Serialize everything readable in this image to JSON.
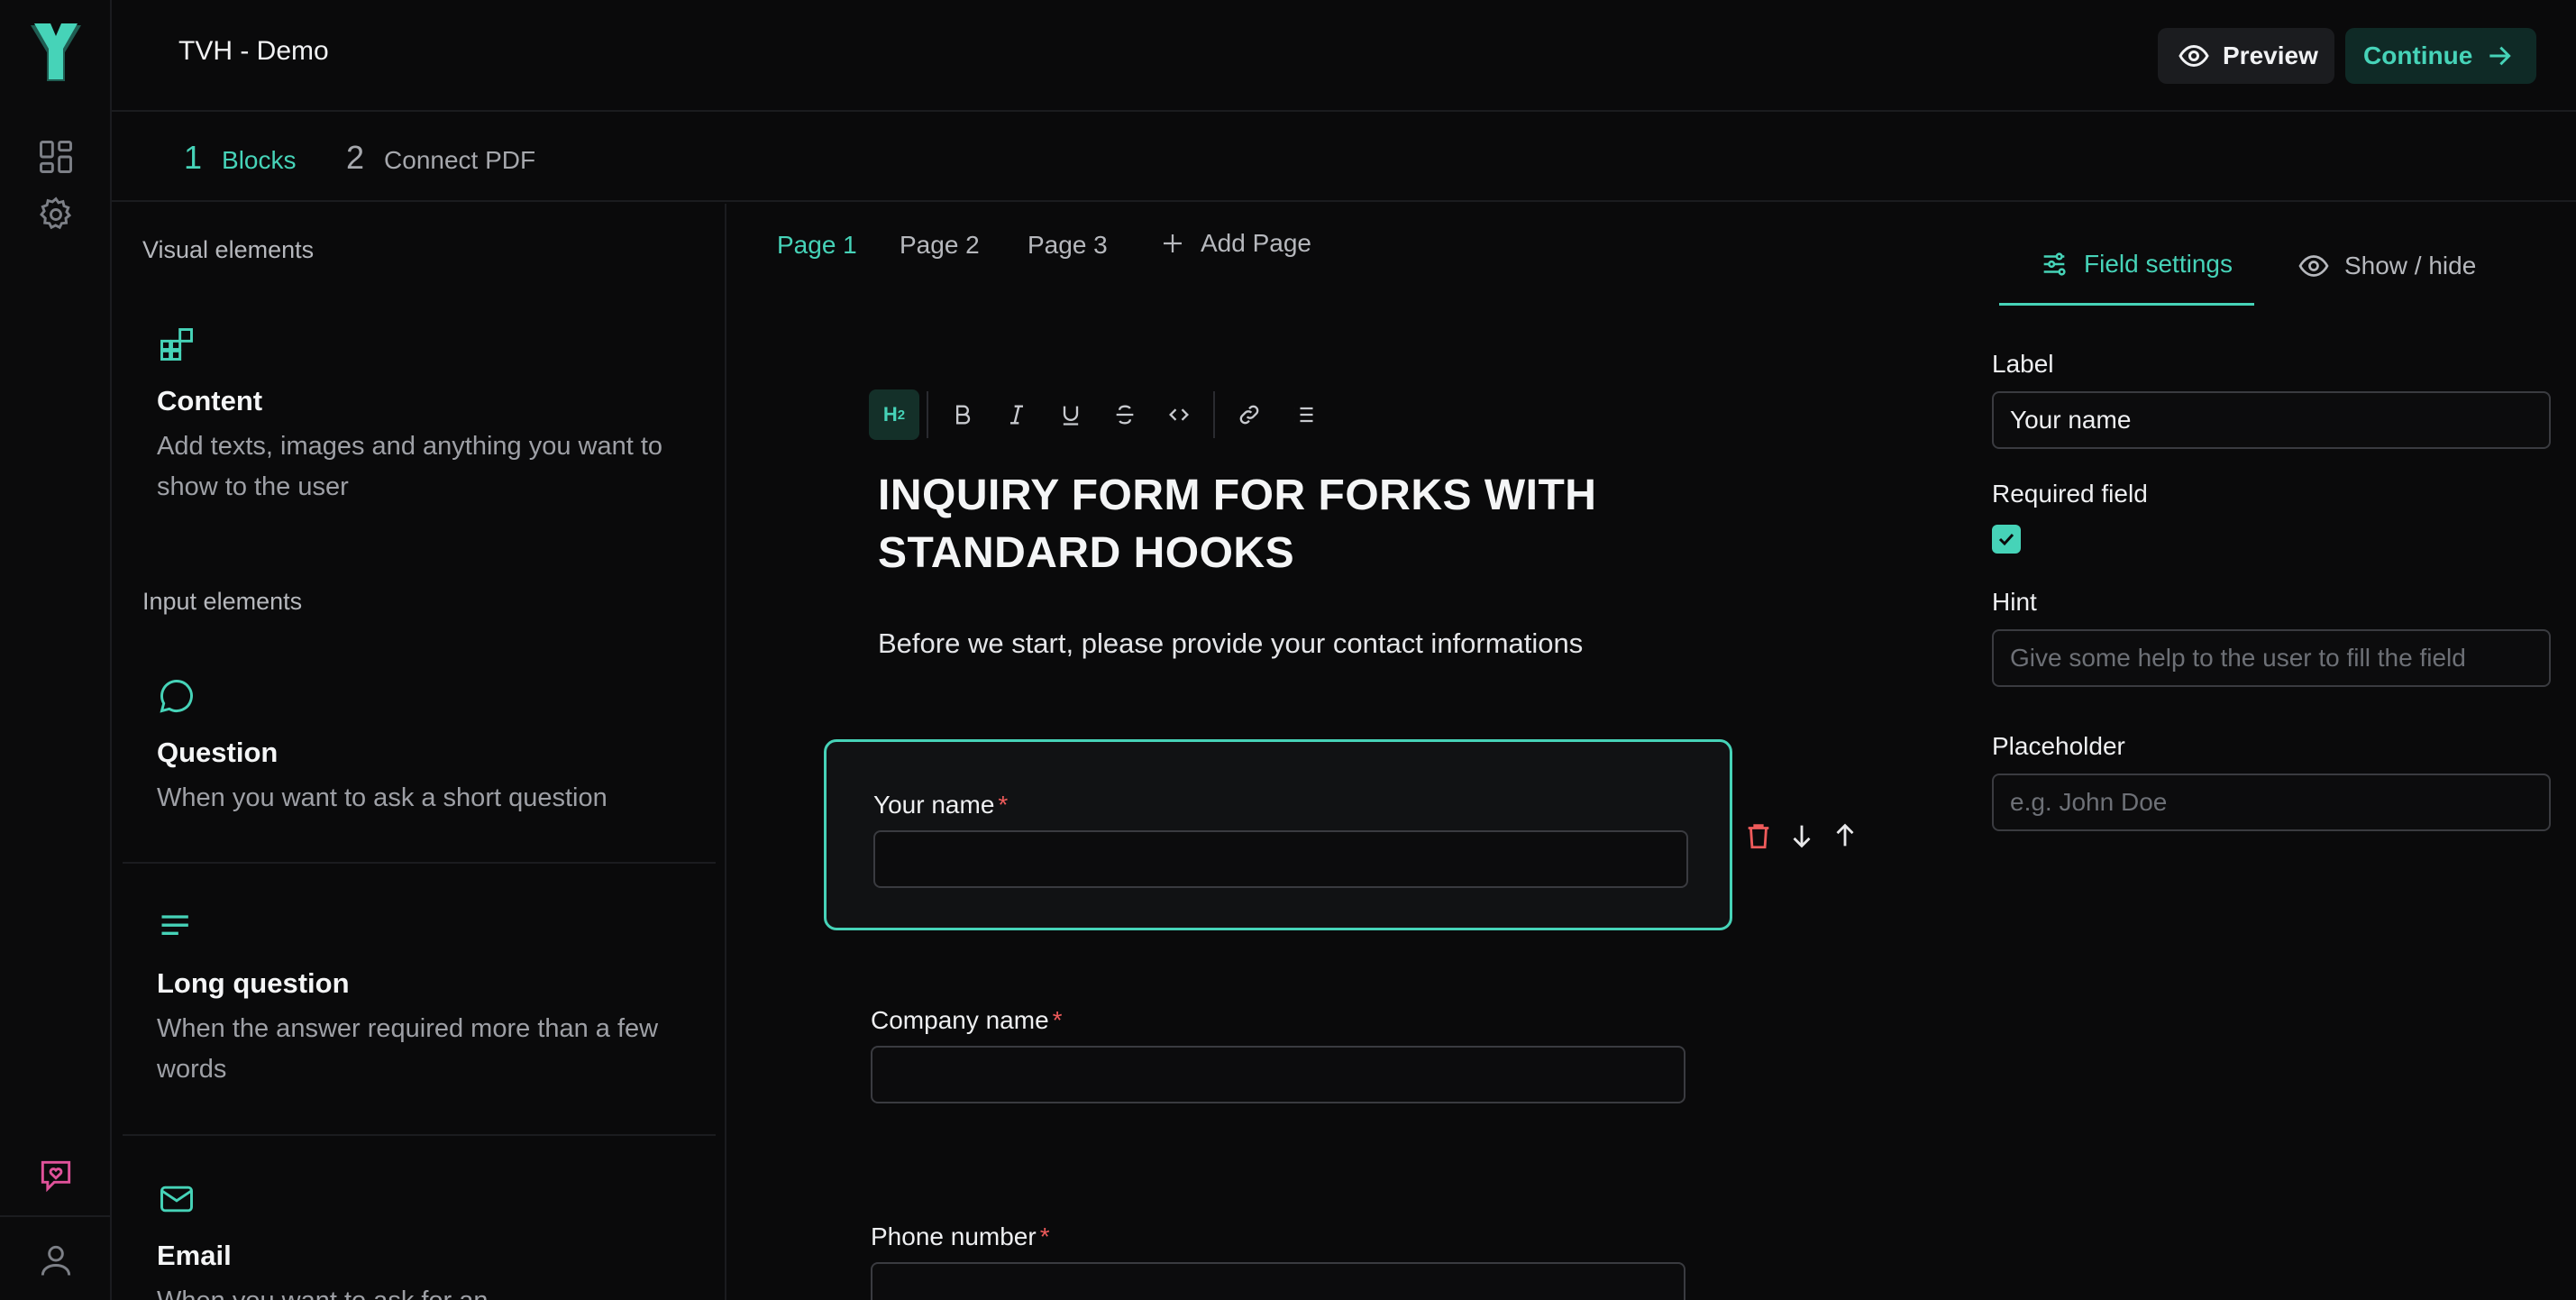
{
  "app": {
    "title": "TVH - Demo"
  },
  "header": {
    "preview_label": "Preview",
    "continue_label": "Continue"
  },
  "steps": [
    {
      "num": "1",
      "label": "Blocks"
    },
    {
      "num": "2",
      "label": "Connect PDF"
    }
  ],
  "palette": {
    "visual_title": "Visual elements",
    "input_title": "Input elements",
    "blocks": [
      {
        "title": "Content",
        "desc": "Add texts, images and anything you want to show to the user"
      },
      {
        "title": "Question",
        "desc": "When you want to ask a short question"
      },
      {
        "title": "Long question",
        "desc": "When the answer required more than a few words"
      },
      {
        "title": "Email",
        "desc": "When you want to ask for an"
      }
    ]
  },
  "editor": {
    "pages": [
      "Page 1",
      "Page 2",
      "Page 3"
    ],
    "add_page": "Add Page",
    "toolbar_h2": "H2",
    "heading": "INQUIRY FORM FOR FORKS WITH STANDARD HOOKS",
    "intro": "Before we start, please provide your contact informations",
    "fields": [
      {
        "label": "Your name",
        "required": "*"
      },
      {
        "label": "Company name",
        "required": "*"
      },
      {
        "label": "Phone number",
        "required": "*"
      }
    ]
  },
  "settings": {
    "tab_field": "Field settings",
    "tab_show": "Show / hide",
    "label_title": "Label",
    "label_value": "Your name",
    "required_title": "Required field",
    "hint_title": "Hint",
    "hint_placeholder": "Give some help to the user to fill the field",
    "placeholder_title": "Placeholder",
    "placeholder_placeholder": "e.g. John Doe"
  },
  "colors": {
    "accent": "#46d3b8",
    "danger": "#ef5b5b",
    "brand_pink": "#e0529a"
  }
}
